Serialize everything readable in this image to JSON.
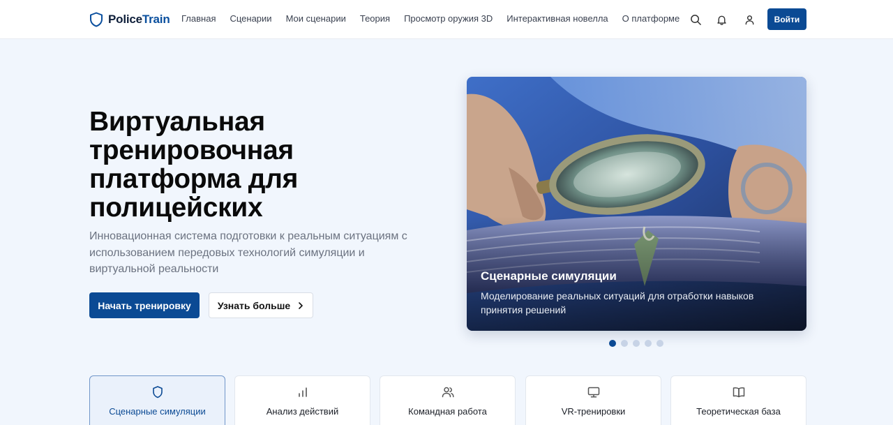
{
  "brand": {
    "name_dark": "Police",
    "name_accent": "Train"
  },
  "nav": {
    "items": [
      "Главная",
      "Сценарии",
      "Мои сценарии",
      "Теория",
      "Просмотр оружия 3D",
      "Интерактивная новелла",
      "О платформе"
    ]
  },
  "header": {
    "icons": [
      "search-icon",
      "bell-icon",
      "user-icon"
    ],
    "login_label": "Войти"
  },
  "hero": {
    "title": "Виртуальная тренировочная платформа для полицейских",
    "subtitle": "Инновационная система подготовки к реальным ситуациям с использованием передовых технологий симуляции и виртуальной реальности",
    "primary_button": "Начать тренировку",
    "secondary_button": "Узнать больше"
  },
  "carousel": {
    "slide_title": "Сценарные симуляции",
    "slide_description": "Моделирование реальных ситуаций для отработки навыков принятия решений",
    "slide_count": 5,
    "active_index": 0
  },
  "features": [
    {
      "label": "Сценарные симуляции",
      "icon": "shield-icon",
      "active": true
    },
    {
      "label": "Анализ действий",
      "icon": "bar-chart-icon",
      "active": false
    },
    {
      "label": "Командная работа",
      "icon": "users-icon",
      "active": false
    },
    {
      "label": "VR-тренировки",
      "icon": "monitor-icon",
      "active": false
    },
    {
      "label": "Теоретическая база",
      "icon": "book-icon",
      "active": false
    }
  ],
  "colors": {
    "primary": "#0b4a94",
    "page_background": "#f1f6fd",
    "text_muted": "#6b7280"
  }
}
